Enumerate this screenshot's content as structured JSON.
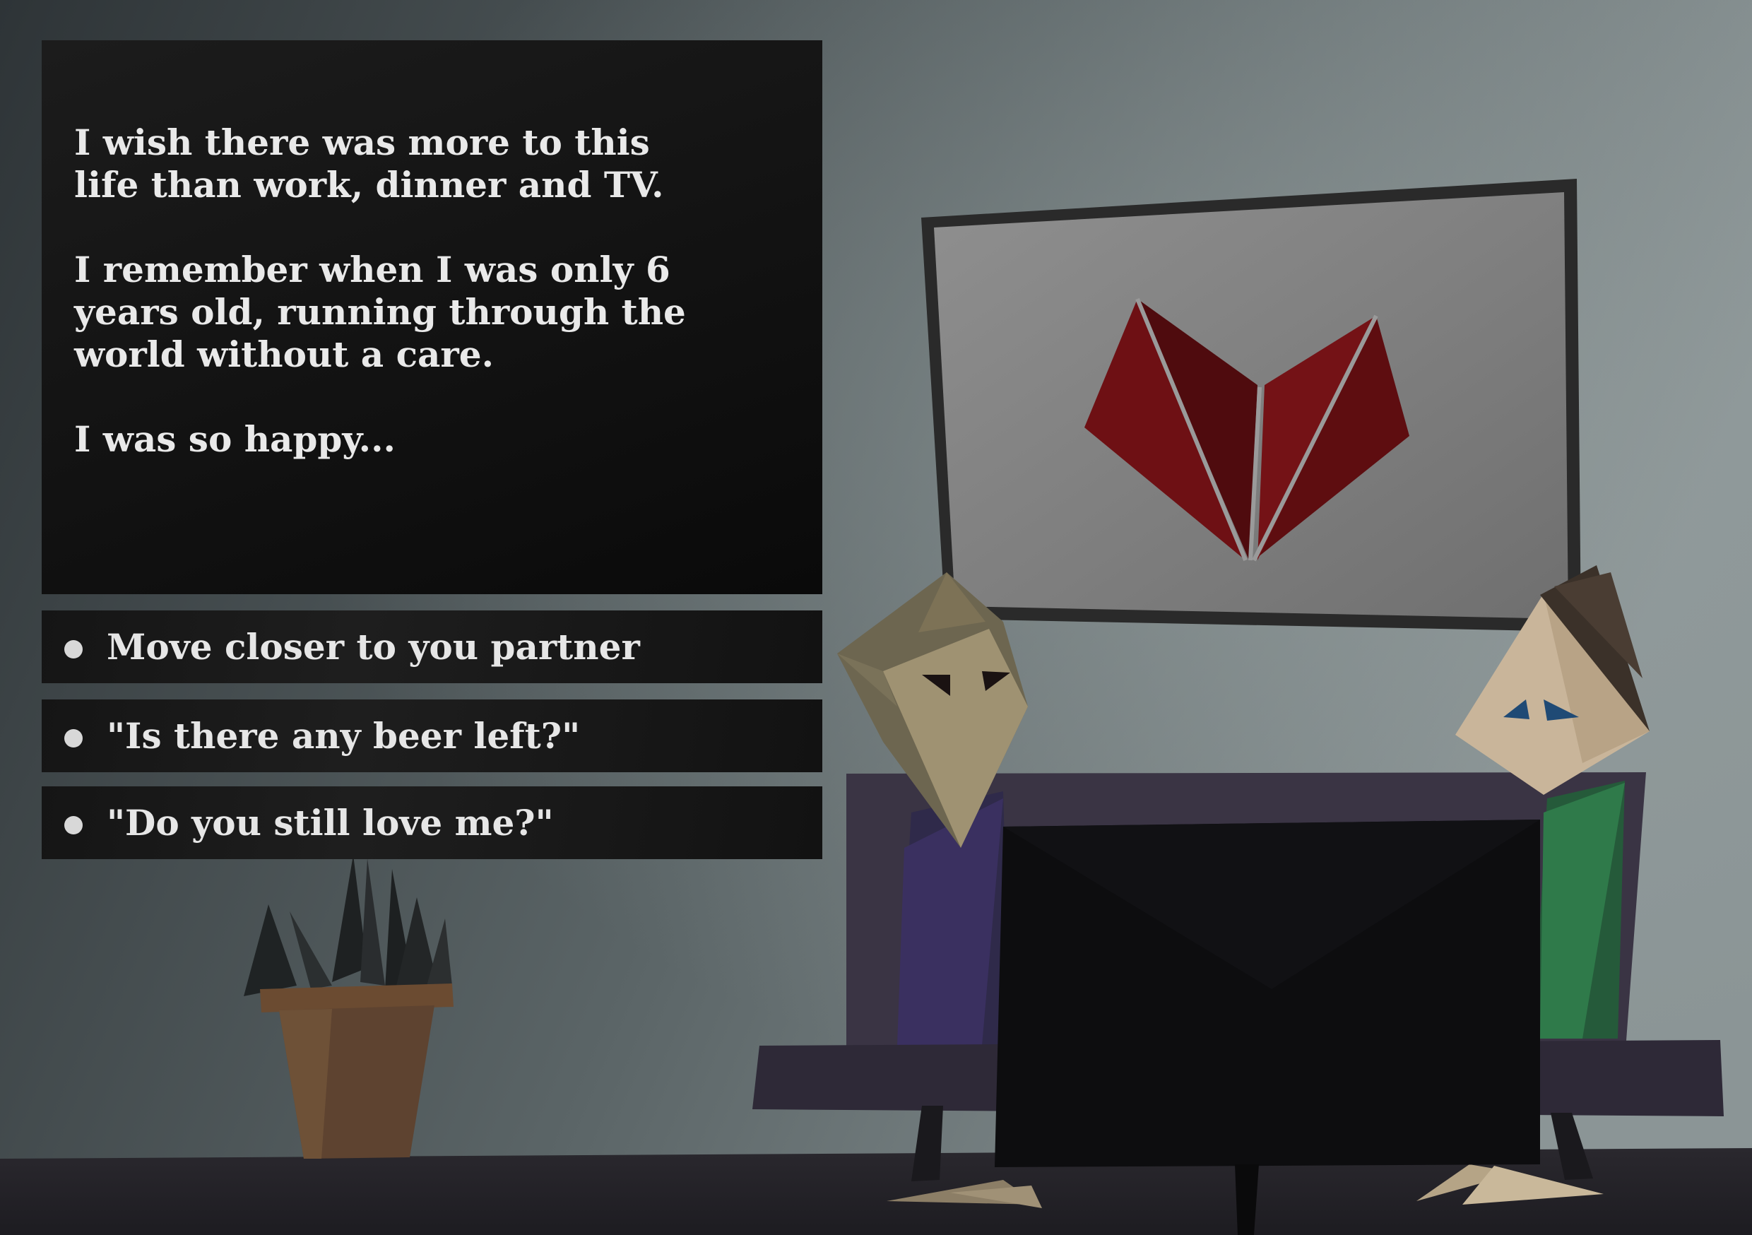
{
  "narration": {
    "paragraphs": [
      "I wish there was more to this\nlife than work, dinner and TV.",
      "I remember when I was only 6\nyears old, running through the\nworld without a care.",
      "I was so happy..."
    ]
  },
  "choices": [
    {
      "label": "Move closer to you partner"
    },
    {
      "label": "\"Is there any beer left?\""
    },
    {
      "label": "\"Do you still love me?\""
    }
  ],
  "colors": {
    "wall": "#5e6a6c",
    "poster_heart": "#6b0f12",
    "couch": "#2e2a36",
    "tv": "#0d0d0f",
    "panel": "#111111",
    "text": "#e9e9e9"
  },
  "icons": {
    "poster": "broken-heart-icon",
    "bullet": "bullet-dot-icon"
  }
}
